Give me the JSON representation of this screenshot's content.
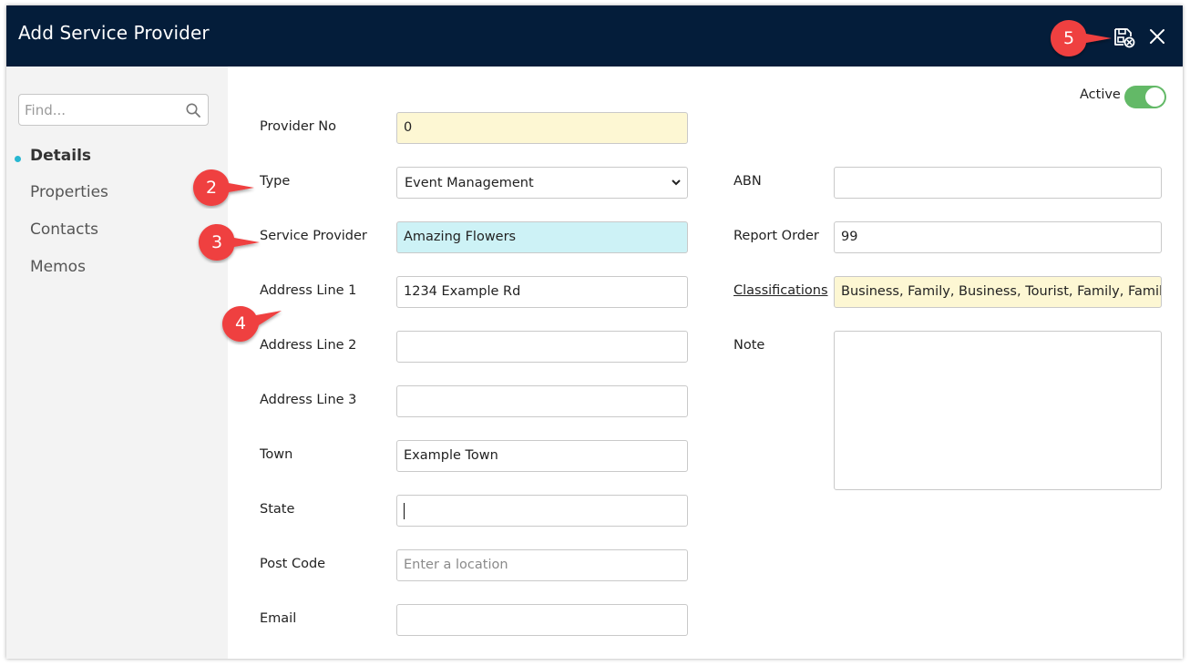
{
  "dialog": {
    "title": "Add Service Provider",
    "save_close_icon": "save-close-icon",
    "close_icon": "close-icon"
  },
  "sidebar": {
    "find_placeholder": "Find...",
    "items": [
      {
        "label": "Details",
        "active": true
      },
      {
        "label": "Properties",
        "active": false
      },
      {
        "label": "Contacts",
        "active": false
      },
      {
        "label": "Memos",
        "active": false
      }
    ]
  },
  "form": {
    "active_label": "Active",
    "active_on": true,
    "provider_no": {
      "label": "Provider No",
      "value": "0"
    },
    "type": {
      "label": "Type",
      "value": "Event Management"
    },
    "service_provider": {
      "label": "Service Provider",
      "value": "Amazing Flowers"
    },
    "address_line_1": {
      "label": "Address Line 1",
      "value": "1234 Example Rd"
    },
    "address_line_2": {
      "label": "Address Line 2",
      "value": ""
    },
    "address_line_3": {
      "label": "Address Line 3",
      "value": ""
    },
    "town": {
      "label": "Town",
      "value": "Example Town"
    },
    "state": {
      "label": "State",
      "value": ""
    },
    "post_code": {
      "label": "Post Code",
      "value": "",
      "placeholder": "Enter a location"
    },
    "email": {
      "label": "Email",
      "value": ""
    },
    "abn": {
      "label": "ABN",
      "value": ""
    },
    "report_order": {
      "label": "Report Order",
      "value": "99"
    },
    "classifications": {
      "label": "Classifications",
      "value": "Business, Family, Business, Tourist, Family, Family, Sp"
    },
    "note": {
      "label": "Note",
      "value": ""
    }
  },
  "callouts": {
    "c2": "2",
    "c3": "3",
    "c4": "4",
    "c5": "5",
    "color": "#ef3f3f"
  },
  "colors": {
    "titlebar": "#041d3a",
    "sidebar": "#f3f3f3",
    "accent_dot": "#27b7d1",
    "toggle_on": "#63b967",
    "field_yellow": "#fdf7d3",
    "field_cyan": "#cdf2f6"
  }
}
